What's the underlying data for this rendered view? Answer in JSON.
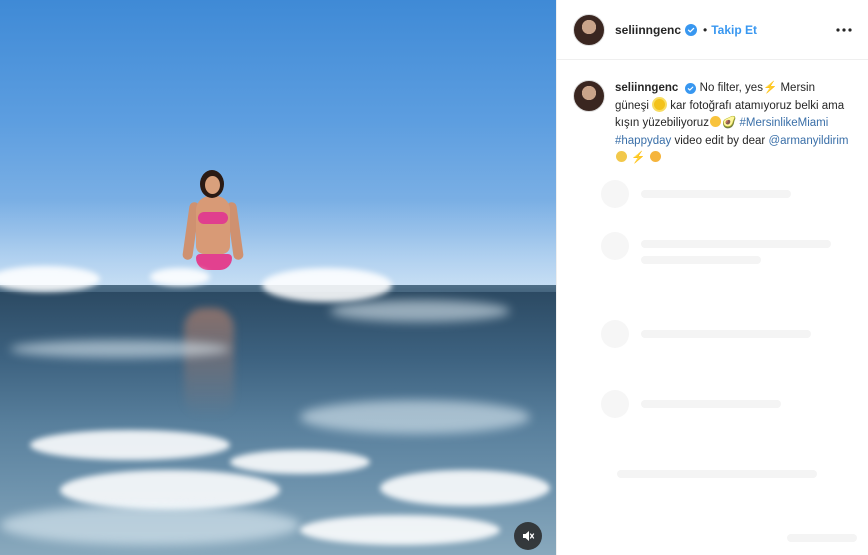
{
  "post": {
    "username": "seliinngenc",
    "follow_label": "Takip Et",
    "separator": "•"
  },
  "caption": {
    "username": "seliinngenc",
    "text_1": " No filter, yes",
    "bolt_1": "⚡",
    "text_2": " Mersin güneşi ",
    "text_3": " kar fotoğrafı atamıyoruz belki ama kışın yüzebiliyoruz",
    "tail_emoji": "🥑",
    "hashtag_1": "#MersinlikeMiami",
    "hashtag_2": "#happyday",
    "text_4": " video edit by dear ",
    "mention": "@armanyildirim",
    "end_emojis": "⚡"
  },
  "icons": {
    "more": "more-options-icon",
    "verified": "verified-badge-icon",
    "mute": "speaker-muted-icon"
  },
  "colors": {
    "link": "#3897f0",
    "hashtag": "#3a6fa8",
    "text": "#262626"
  }
}
